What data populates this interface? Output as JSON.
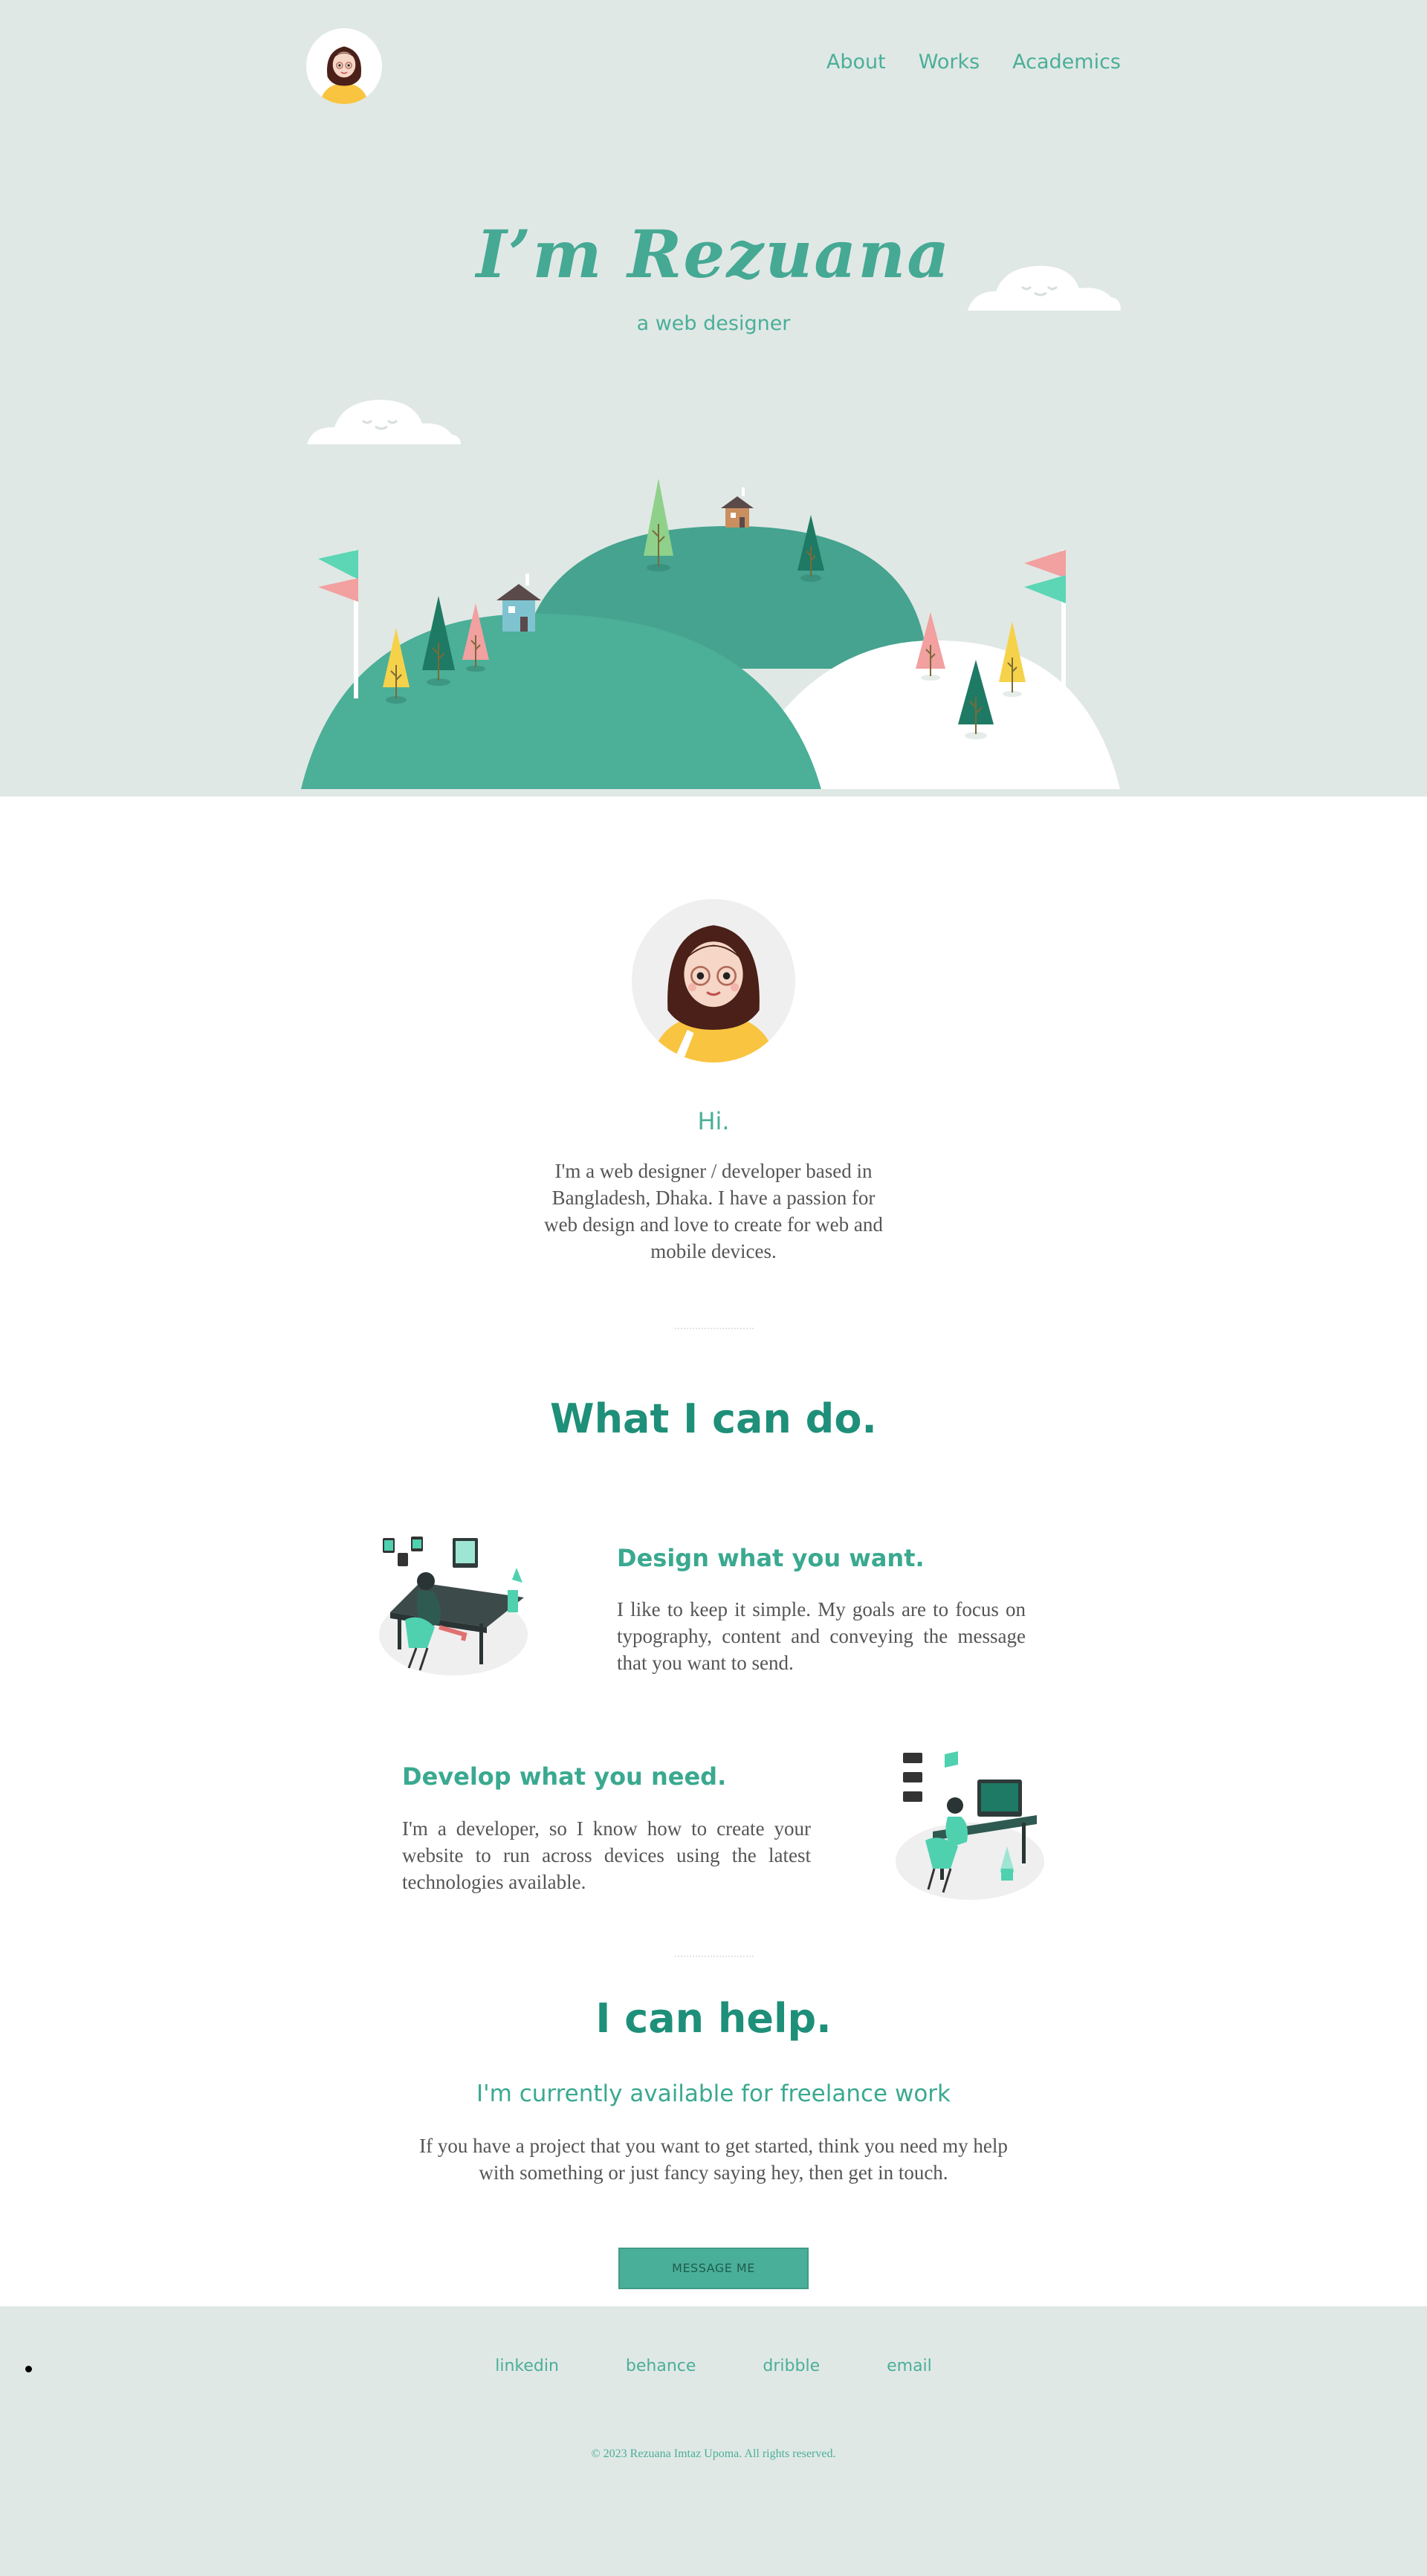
{
  "nav": {
    "items": [
      {
        "label": "About"
      },
      {
        "label": "Works"
      },
      {
        "label": "Academics"
      }
    ]
  },
  "hero": {
    "title": "I’m Rezuana",
    "subtitle": "a web designer"
  },
  "about": {
    "greeting": "Hi.",
    "intro": "I'm a web designer / developer based in Bangladesh, Dhaka. I have a passion for web design and love to create for web and mobile devices."
  },
  "services": {
    "title": "What I can do.",
    "items": [
      {
        "heading": "Design what you want.",
        "text": "I like to keep it simple. My goals are to focus on typography, content and conveying the message that you want to send."
      },
      {
        "heading": "Develop what you need.",
        "text": "I'm a developer, so I know how to create your website to run across devices using the latest technologies available."
      }
    ]
  },
  "help": {
    "title": "I can help.",
    "subtitle": "I'm currently available for freelance work",
    "text": "If you have a project that you want to get started, think you need my help with something or just fancy saying hey, then get in touch.",
    "button_label": "MESSAGE ME"
  },
  "footer": {
    "links": [
      {
        "label": "linkedin"
      },
      {
        "label": "behance"
      },
      {
        "label": "dribble"
      },
      {
        "label": "email"
      }
    ],
    "copyright": "© 2023 Rezuana Imtaz Upoma. All rights reserved."
  },
  "colors": {
    "accent": "#4aaf99",
    "heading": "#1e8f79",
    "hero_bg": "#e0e8e5",
    "body_text": "#555555"
  },
  "icons": [
    "avatar",
    "cloud",
    "hills-illustration",
    "flag",
    "tree",
    "house",
    "designer-illustration",
    "developer-illustration"
  ]
}
